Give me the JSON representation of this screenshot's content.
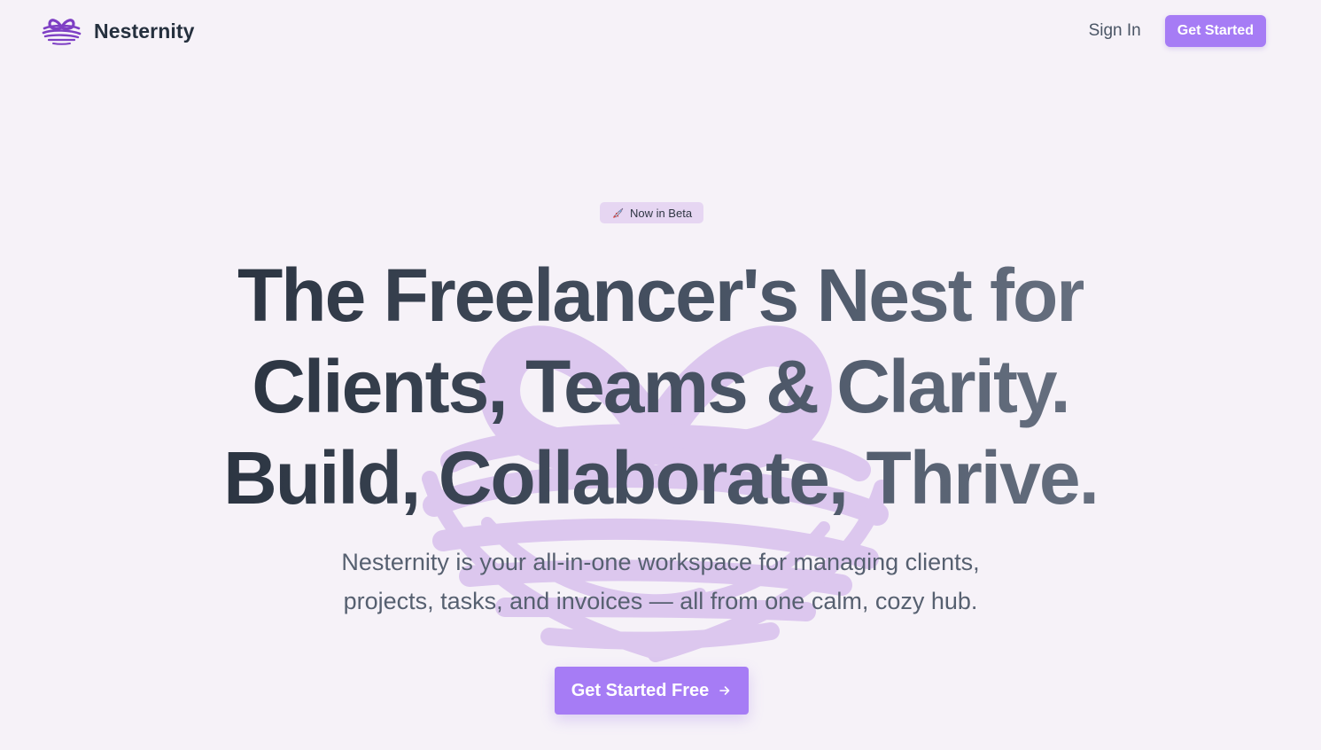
{
  "brand": {
    "name": "Nesternity",
    "logo_icon": "nest-logo-icon",
    "accent_color": "#7e3fc4"
  },
  "nav": {
    "signin_label": "Sign In",
    "get_started_label": "Get Started"
  },
  "hero": {
    "badge": {
      "icon": "rocket-icon",
      "label": "Now in Beta"
    },
    "headline": [
      "The Freelancer's Nest for",
      "Clients, Teams & Clarity.",
      "Build, Collaborate, Thrive."
    ],
    "subheadline": [
      "Nesternity is your all-in-one workspace for managing clients,",
      "projects, tasks, and invoices — all from one calm, cozy hub."
    ],
    "cta": {
      "label": "Get Started Free",
      "icon": "arrow-right-icon"
    },
    "watermark_icon": "nest-watermark-icon"
  },
  "colors": {
    "background": "#f6f2f8",
    "primary_button": "#a67cf5",
    "badge_bg": "#e6d6f2",
    "watermark": "#dcc6ec",
    "heading": "#2c3542"
  }
}
